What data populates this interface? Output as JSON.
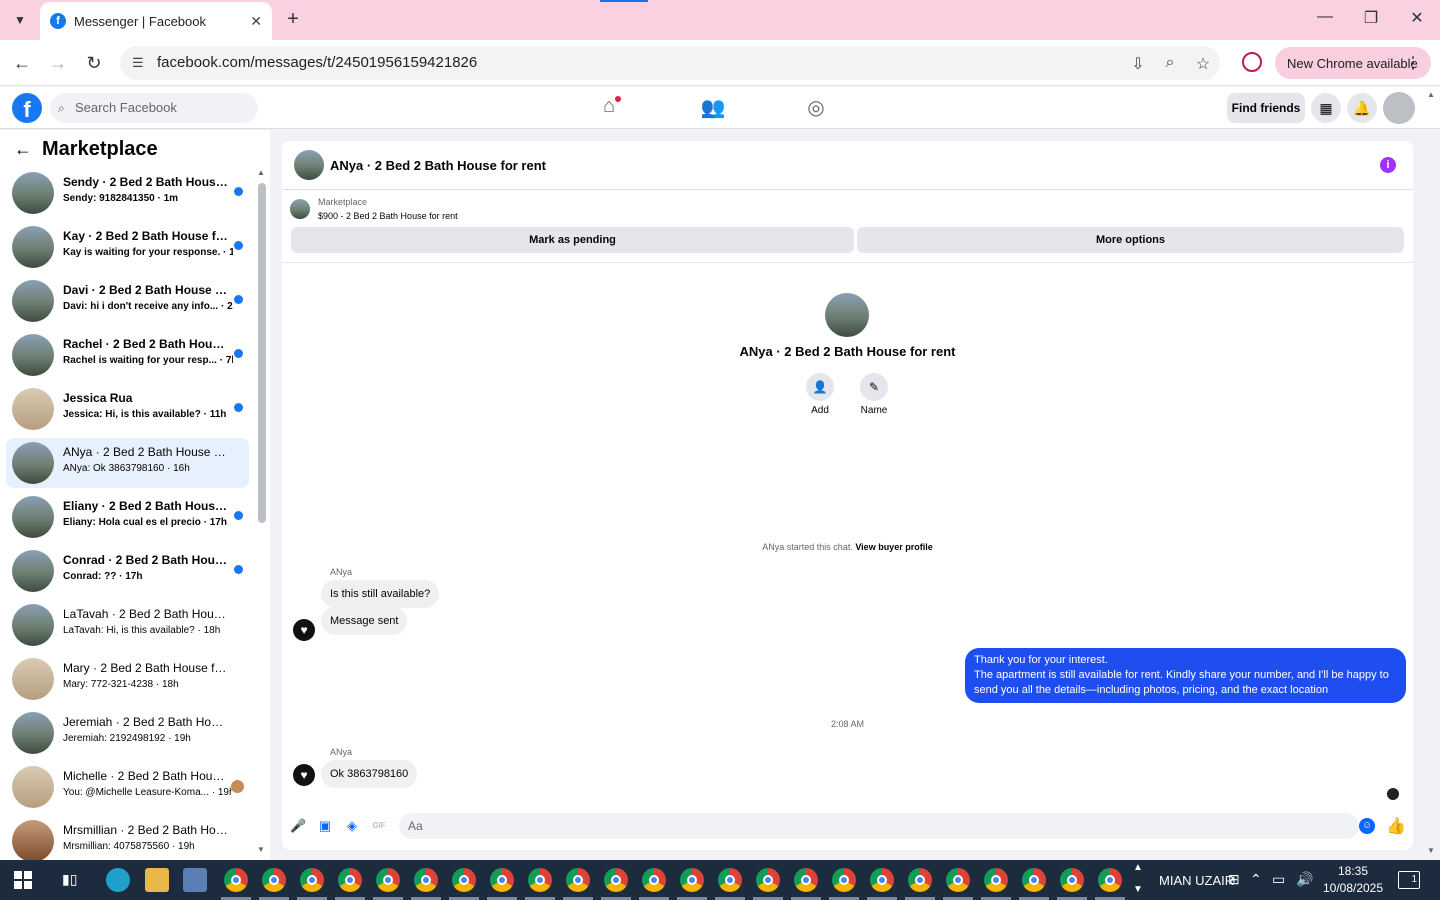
{
  "browser": {
    "tab_title": "Messenger | Facebook",
    "url": "facebook.com/messages/t/24501956159421826",
    "new_chrome_label": "New Chrome available"
  },
  "fb": {
    "search_placeholder": "Search Facebook",
    "find_friends": "Find friends"
  },
  "left": {
    "title": "Marketplace",
    "conversations": [
      {
        "name": "Sendy · 2 Bed 2 Bath House f...",
        "snippet": "Sendy: 9182841350 · 1m",
        "unread": true,
        "avatar": "house"
      },
      {
        "name": "Kay · 2 Bed 2 Bath House for r...",
        "snippet": "Kay is waiting for your response. · 1h",
        "unread": true,
        "avatar": "house"
      },
      {
        "name": "Davi · 2 Bed 2 Bath House for ...",
        "snippet": "Davi: hi i don't receive any info... · 2h",
        "unread": true,
        "avatar": "house"
      },
      {
        "name": "Rachel · 2 Bed 2 Bath House f...",
        "snippet": "Rachel is waiting for your resp... · 7h",
        "unread": true,
        "avatar": "house"
      },
      {
        "name": "Jessica Rua",
        "snippet": "Jessica: Hi, is this available? · 11h",
        "unread": true,
        "avatar": "beige"
      },
      {
        "name": "ANya · 2 Bed 2 Bath House for r...",
        "snippet": "ANya: Ok 3863798160 · 16h",
        "unread": false,
        "active": true,
        "avatar": "house"
      },
      {
        "name": "Eliany · 2 Bed 2 Bath House fo...",
        "snippet": "Eliany: Hola cual es el precio · 17h",
        "unread": true,
        "avatar": "house"
      },
      {
        "name": "Conrad · 2 Bed 2 Bath House ...",
        "snippet": "Conrad: ?? · 17h",
        "unread": true,
        "avatar": "house"
      },
      {
        "name": "LaTavah · 2 Bed 2 Bath House f...",
        "snippet": "LaTavah: Hi, is this available? · 18h",
        "unread": false,
        "avatar": "house"
      },
      {
        "name": "Mary · 2 Bed 2 Bath House for r...",
        "snippet": "Mary: 772-321-4238 · 18h",
        "unread": false,
        "avatar": "beige"
      },
      {
        "name": "Jeremiah · 2 Bed 2 Bath House f...",
        "snippet": "Jeremiah: 2192498192 · 19h",
        "unread": false,
        "avatar": "house"
      },
      {
        "name": "Michelle · 2 Bed 2 Bath Hous...",
        "snippet": "You: @Michelle Leasure-Koma... · 19h",
        "unread": false,
        "avatar": "beige",
        "mini_avatar": true
      },
      {
        "name": "Mrsmillian · 2 Bed 2 Bath Hous...",
        "snippet": "Mrsmillian: 4075875560 · 19h",
        "unread": false,
        "avatar": "room"
      }
    ]
  },
  "chat": {
    "title": "ANya · 2 Bed 2 Bath House for rent",
    "marketplace_label": "Marketplace",
    "listing": "$900 - 2 Bed 2 Bath House for rent",
    "mark_pending": "Mark as pending",
    "more_options": "More options",
    "profile_title": "ANya · 2 Bed 2 Bath House for rent",
    "add_label": "Add",
    "name_label": "Name",
    "started_text": "ANya started this chat.",
    "view_profile": "View buyer profile",
    "sender1": "ANya",
    "msg1": "Is this still available?",
    "msg2": "Message sent",
    "out_line1": "Thank you for your interest.",
    "out_line2": "The apartment is still available for rent. Kindly share your number, and I'll be happy to send you all the details—including photos, pricing, and the exact location",
    "time_sep": "2:08 AM",
    "sender2": "ANya",
    "msg3": "Ok 3863798160",
    "composer_placeholder": "Aa"
  },
  "taskbar": {
    "user": "MIAN UZAIR",
    "time": "18:35",
    "date": "10/08/2025",
    "notif_count": "1"
  }
}
